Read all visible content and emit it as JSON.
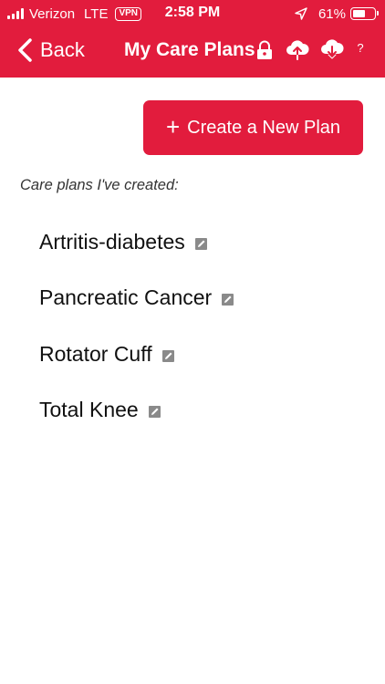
{
  "status_bar": {
    "carrier": "Verizon",
    "network": "LTE",
    "vpn": "VPN",
    "time": "2:58 PM",
    "battery_percent": "61%",
    "battery_level": 0.61
  },
  "nav": {
    "back_label": "Back",
    "title": "My Care Plans",
    "help_label": "?"
  },
  "create_button": {
    "plus": "+",
    "label": "Create a New Plan"
  },
  "section_label": "Care plans I've created:",
  "plans": [
    {
      "name": "Artritis-diabetes"
    },
    {
      "name": "Pancreatic Cancer"
    },
    {
      "name": "Rotator Cuff"
    },
    {
      "name": "Total Knee"
    }
  ],
  "icons": {
    "signal": "cellular-signal-icon",
    "location": "location-arrow-icon",
    "battery": "battery-icon",
    "back": "chevron-left-icon",
    "lock": "lock-icon",
    "upload": "cloud-upload-icon",
    "download": "cloud-download-icon",
    "edit": "edit-icon"
  },
  "colors": {
    "accent": "#e21c3d",
    "text": "#111111",
    "edit_icon": "#7a7a7a"
  }
}
